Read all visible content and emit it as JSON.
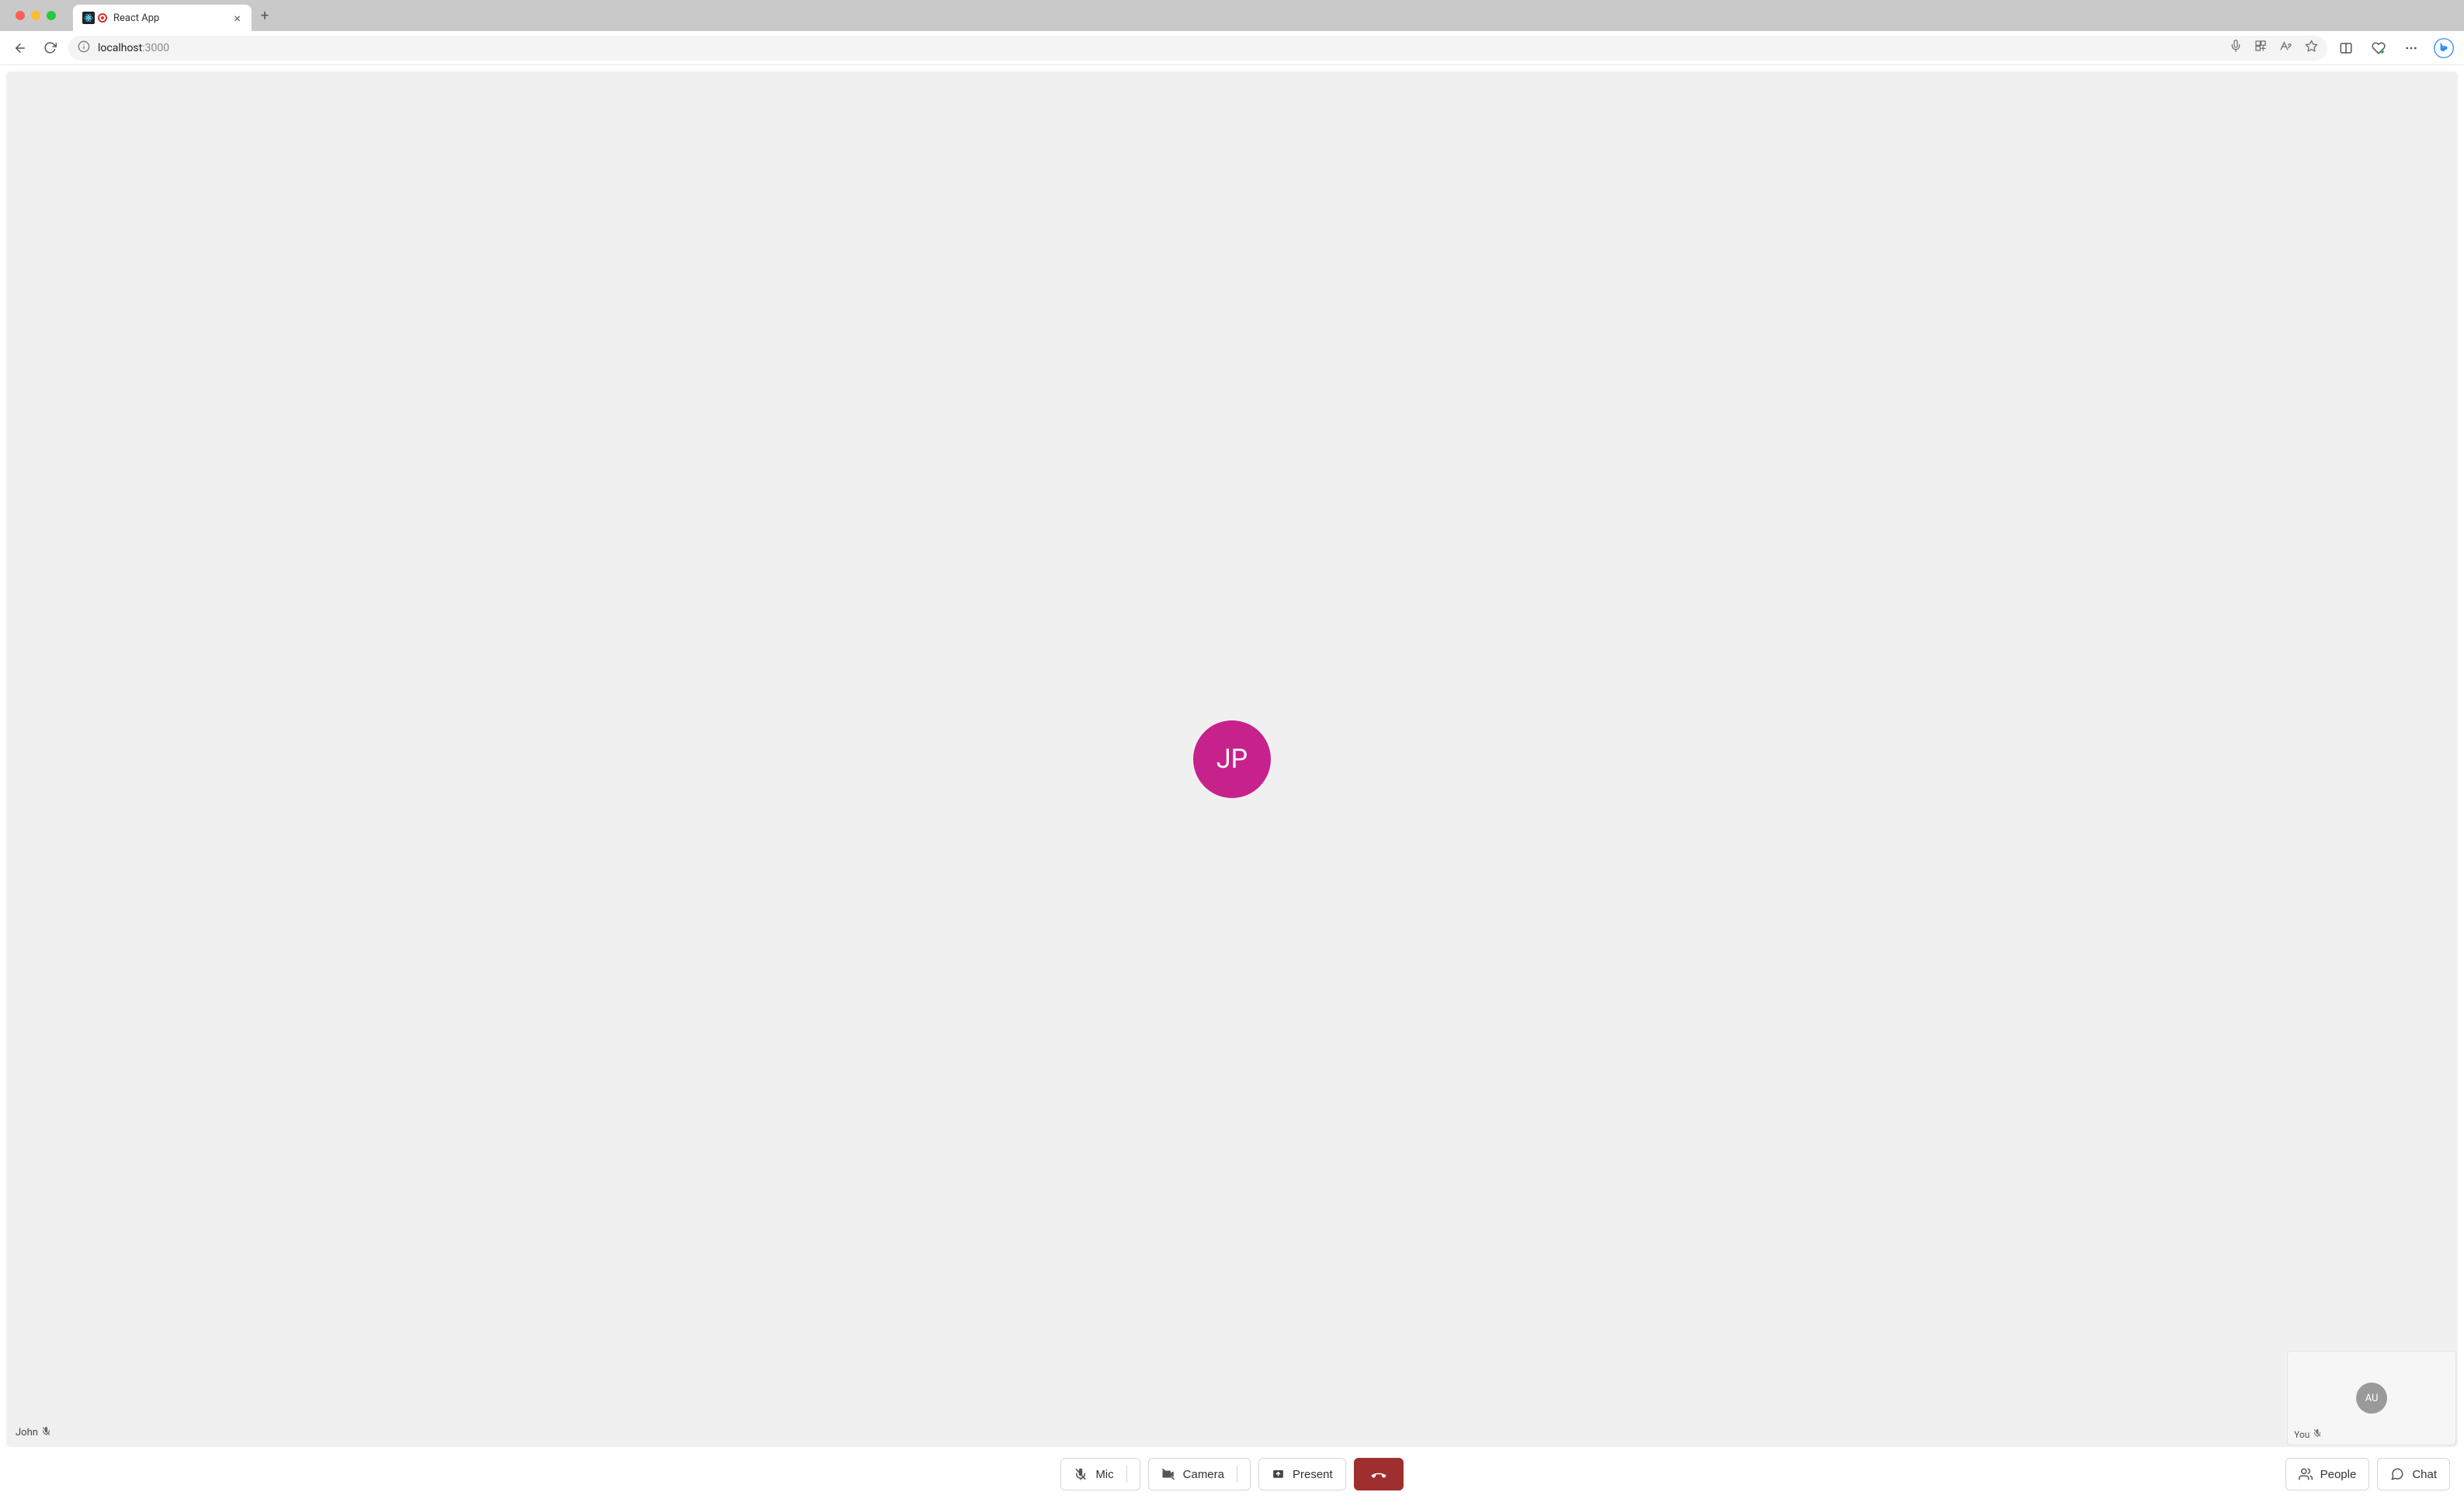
{
  "browser": {
    "tab_title": "React App",
    "url_host": "localhost",
    "url_port": ":3000"
  },
  "call": {
    "main_participant": {
      "name": "John",
      "initials": "JP",
      "avatar_color": "#c7228c",
      "muted": true
    },
    "self_preview": {
      "name": "You",
      "initials": "AU",
      "muted": true
    },
    "controls": {
      "mic": "Mic",
      "camera": "Camera",
      "present": "Present",
      "people": "People",
      "chat": "Chat"
    }
  }
}
